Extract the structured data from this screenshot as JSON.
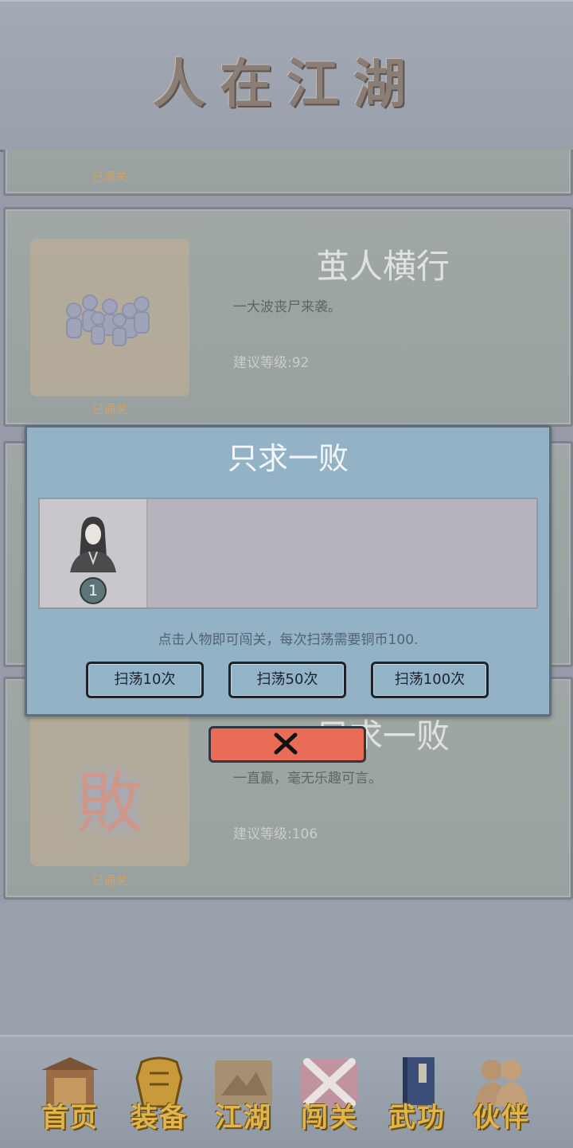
{
  "header": {
    "title": "人在江湖"
  },
  "levels": [
    {
      "status": "已通关"
    },
    {
      "title": "茧人横行",
      "description": "一大波丧尸来袭。",
      "recommend": "建议等级:92",
      "status": "已通关"
    },
    {
      "title": "只求一败",
      "description": "一直赢，毫无乐趣可言。",
      "recommend": "建议等级:106",
      "status": "已通关",
      "thumb_char": "敗"
    }
  ],
  "dialog": {
    "title": "只求一败",
    "members": [
      {
        "badge": "1"
      }
    ],
    "hint": "点击人物即可闯关，每次扫荡需要铜币100.",
    "buttons": {
      "sweep10": "扫荡10次",
      "sweep50": "扫荡50次",
      "sweep100": "扫荡100次"
    },
    "close_icon": "close-x-icon",
    "close_color": "#e96c57"
  },
  "nav": {
    "items": [
      {
        "label": "首页",
        "icon": "temple-icon"
      },
      {
        "label": "装备",
        "icon": "armor-icon"
      },
      {
        "label": "江湖",
        "icon": "scroll-map-icon"
      },
      {
        "label": "闯关",
        "icon": "crossed-swords-icon"
      },
      {
        "label": "武功",
        "icon": "book-icon"
      },
      {
        "label": "伙伴",
        "icon": "partners-icon"
      }
    ],
    "active_index": 3
  },
  "colors": {
    "accent_gold": "#e2b54a",
    "cleared": "#d9a766",
    "dialog_bg": "#94b2c6"
  }
}
